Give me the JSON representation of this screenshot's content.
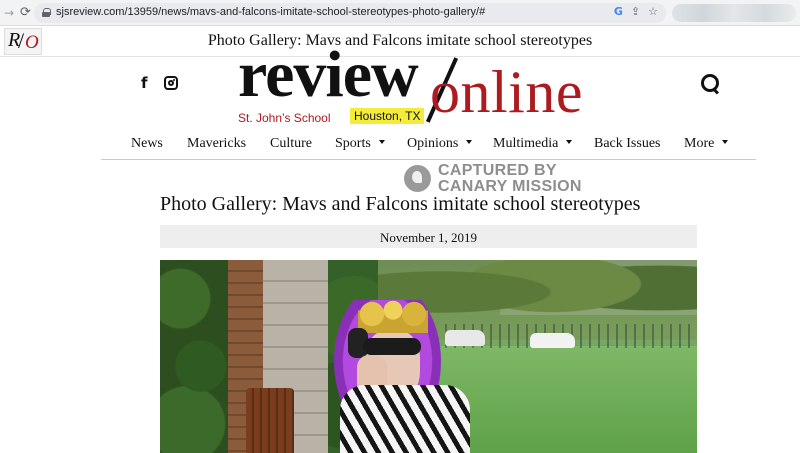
{
  "browser": {
    "url": "sjsreview.com/13959/news/mavs-and-falcons-imitate-school-stereotypes-photo-gallery/#",
    "forward_glyph": "→",
    "reload_glyph": "⟳",
    "addr_icons": [
      "G",
      "⇪",
      "☆"
    ]
  },
  "topbar": {
    "mini_logo": {
      "r": "R",
      "slash": "/",
      "o": "O"
    },
    "title": "Photo Gallery: Mavs and Falcons imitate school stereotypes"
  },
  "masthead": {
    "facebook_glyph": "f",
    "wordmark_left": "review",
    "wordmark_right": "online",
    "school": "St. John’s School",
    "city": "Houston, TX",
    "colors": {
      "brand_red": "#ad1a20",
      "highlight_yellow": "#f4ec3a"
    }
  },
  "nav": {
    "items": [
      {
        "label": "News"
      },
      {
        "label": "Mavericks"
      },
      {
        "label": "Culture"
      },
      {
        "label": "Sports"
      },
      {
        "label": "Opinions"
      },
      {
        "label": "Multimedia"
      },
      {
        "label": "Back Issues"
      },
      {
        "label": "More"
      }
    ]
  },
  "watermark": {
    "line1": "CAPTURED BY",
    "line2": "CANARY MISSION"
  },
  "article": {
    "title": "Photo Gallery: Mavs and Falcons imitate school stereotypes",
    "date": "November 1, 2019"
  }
}
